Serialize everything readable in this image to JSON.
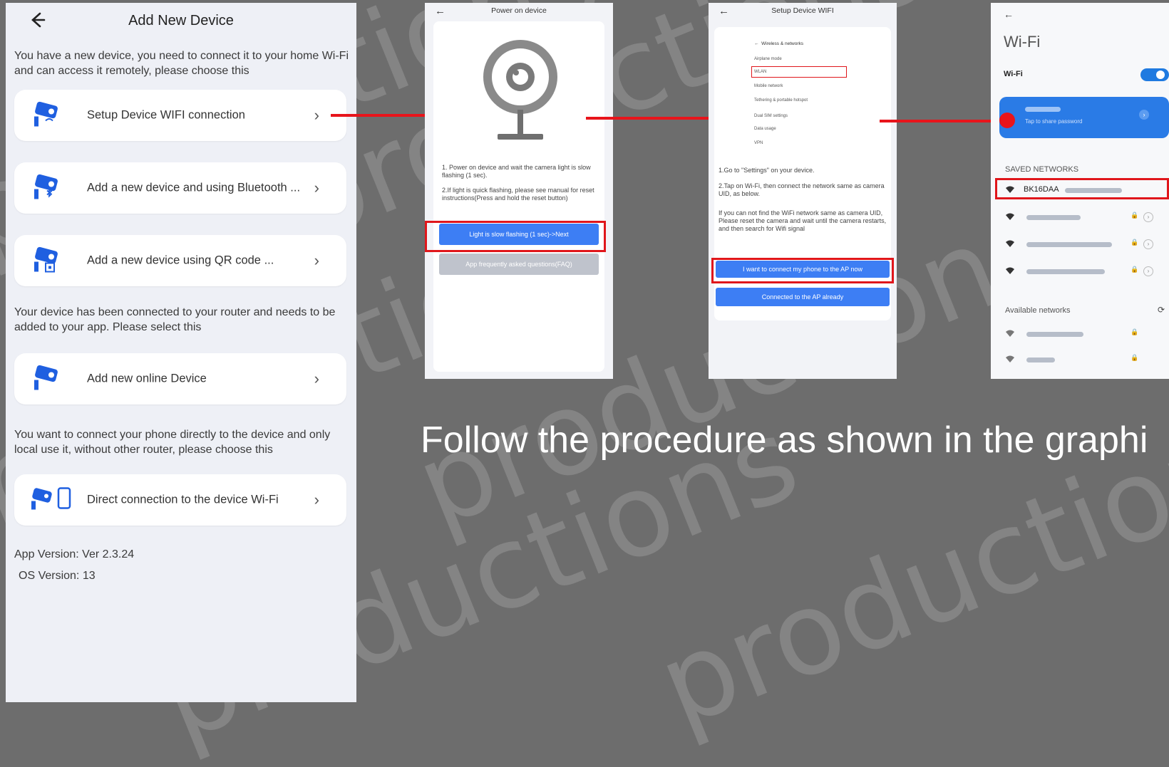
{
  "left_screen": {
    "title": "Add New Device",
    "intro": "You have a new device, you need to connect it to your home Wi-Fi and can access it remotely, please choose this",
    "options": [
      {
        "label": "Setup Device WIFI connection"
      },
      {
        "label": "Add a new device and using Bluetooth ..."
      },
      {
        "label": "Add a new device using QR code ..."
      }
    ],
    "router_text": "Your device has been connected to your router and needs to be added to your app. Please select this",
    "online_option": {
      "label": "Add new online Device"
    },
    "direct_text": "You want to connect your phone directly to the device and only local use it, without other router, please choose this",
    "direct_option": {
      "label": "Direct connection to the device Wi-Fi"
    },
    "app_version": "App Version: Ver 2.3.24",
    "os_version": "OS Version: 13"
  },
  "phone_power": {
    "title": "Power on device",
    "step1": "1. Power on device and wait the camera light is slow flashing (1 sec).",
    "step2": "2.If light is quick flashing, please see manual for reset instructions(Press and hold the reset button)",
    "next_button": "Light is slow flashing (1 sec)->Next",
    "faq_button": "App frequently asked questions(FAQ)"
  },
  "phone_setup": {
    "title": "Setup Device WIFI",
    "mini_settings": {
      "header": "Wireless & networks",
      "rows": [
        "Airplane mode",
        "WLAN",
        "Mobile network",
        "Tethering & portable hotspot",
        "Dual SIM settings",
        "Data usage",
        "VPN"
      ]
    },
    "step1": "1.Go to \"Settings\" on your device.",
    "step2": "2.Tap on Wi-Fi, then connect the network same as camera UID, as below.",
    "step3": "If you can not find the WiFi network same as camera UID, Please reset the camera and wait until the camera restarts, and then search for Wifi signal",
    "ap_button": "I want to connect my phone to the AP now",
    "connected_button": "Connected to the AP already"
  },
  "phone_wifi": {
    "title": "Wi-Fi",
    "toggle_label": "Wi-Fi",
    "connected_hint": "Tap to share password",
    "saved_header": "SAVED NETWORKS",
    "highlight_network": "BK16DAA",
    "available_header": "Available networks"
  },
  "caption": "Follow the procedure as shown in the graphi",
  "colors": {
    "accent_red": "#e8141b",
    "button_blue": "#3d7ef4"
  }
}
